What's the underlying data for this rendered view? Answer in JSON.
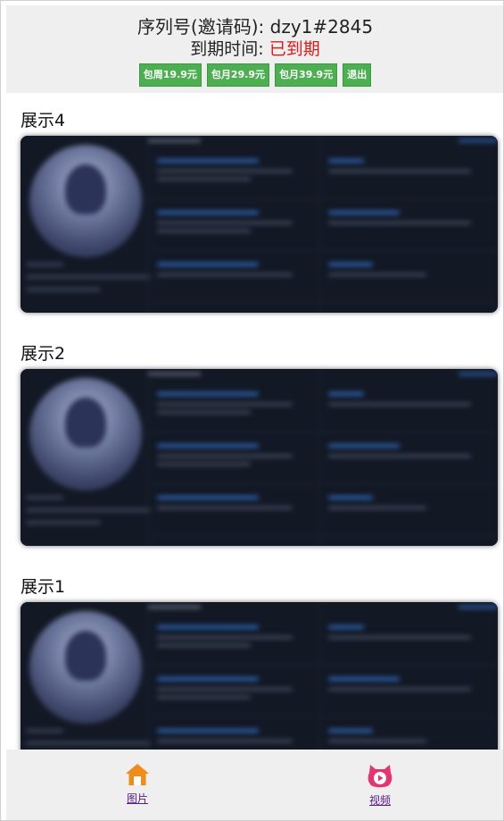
{
  "header": {
    "serial_label": "序列号(邀请码): dzy1#2845",
    "expiry_label": "到期时间: ",
    "expiry_value": "已到期",
    "expiry_color": "#e01a1a",
    "buttons": [
      "包周19.9元",
      "包月29.9元",
      "包月39.9元",
      "退出"
    ],
    "button_color": "#4caf50"
  },
  "sections": [
    {
      "title": "展示4",
      "image": "blurred dashboard screenshot"
    },
    {
      "title": "展示2",
      "image": "blurred dashboard screenshot"
    },
    {
      "title": "展示1",
      "image": "blurred dashboard screenshot"
    }
  ],
  "footer": {
    "tabs": [
      {
        "label": "图片",
        "icon": "home-icon",
        "icon_color": "#f08c1a"
      },
      {
        "label": "视频",
        "icon": "video-icon",
        "icon_color": "#e8336e"
      }
    ]
  }
}
